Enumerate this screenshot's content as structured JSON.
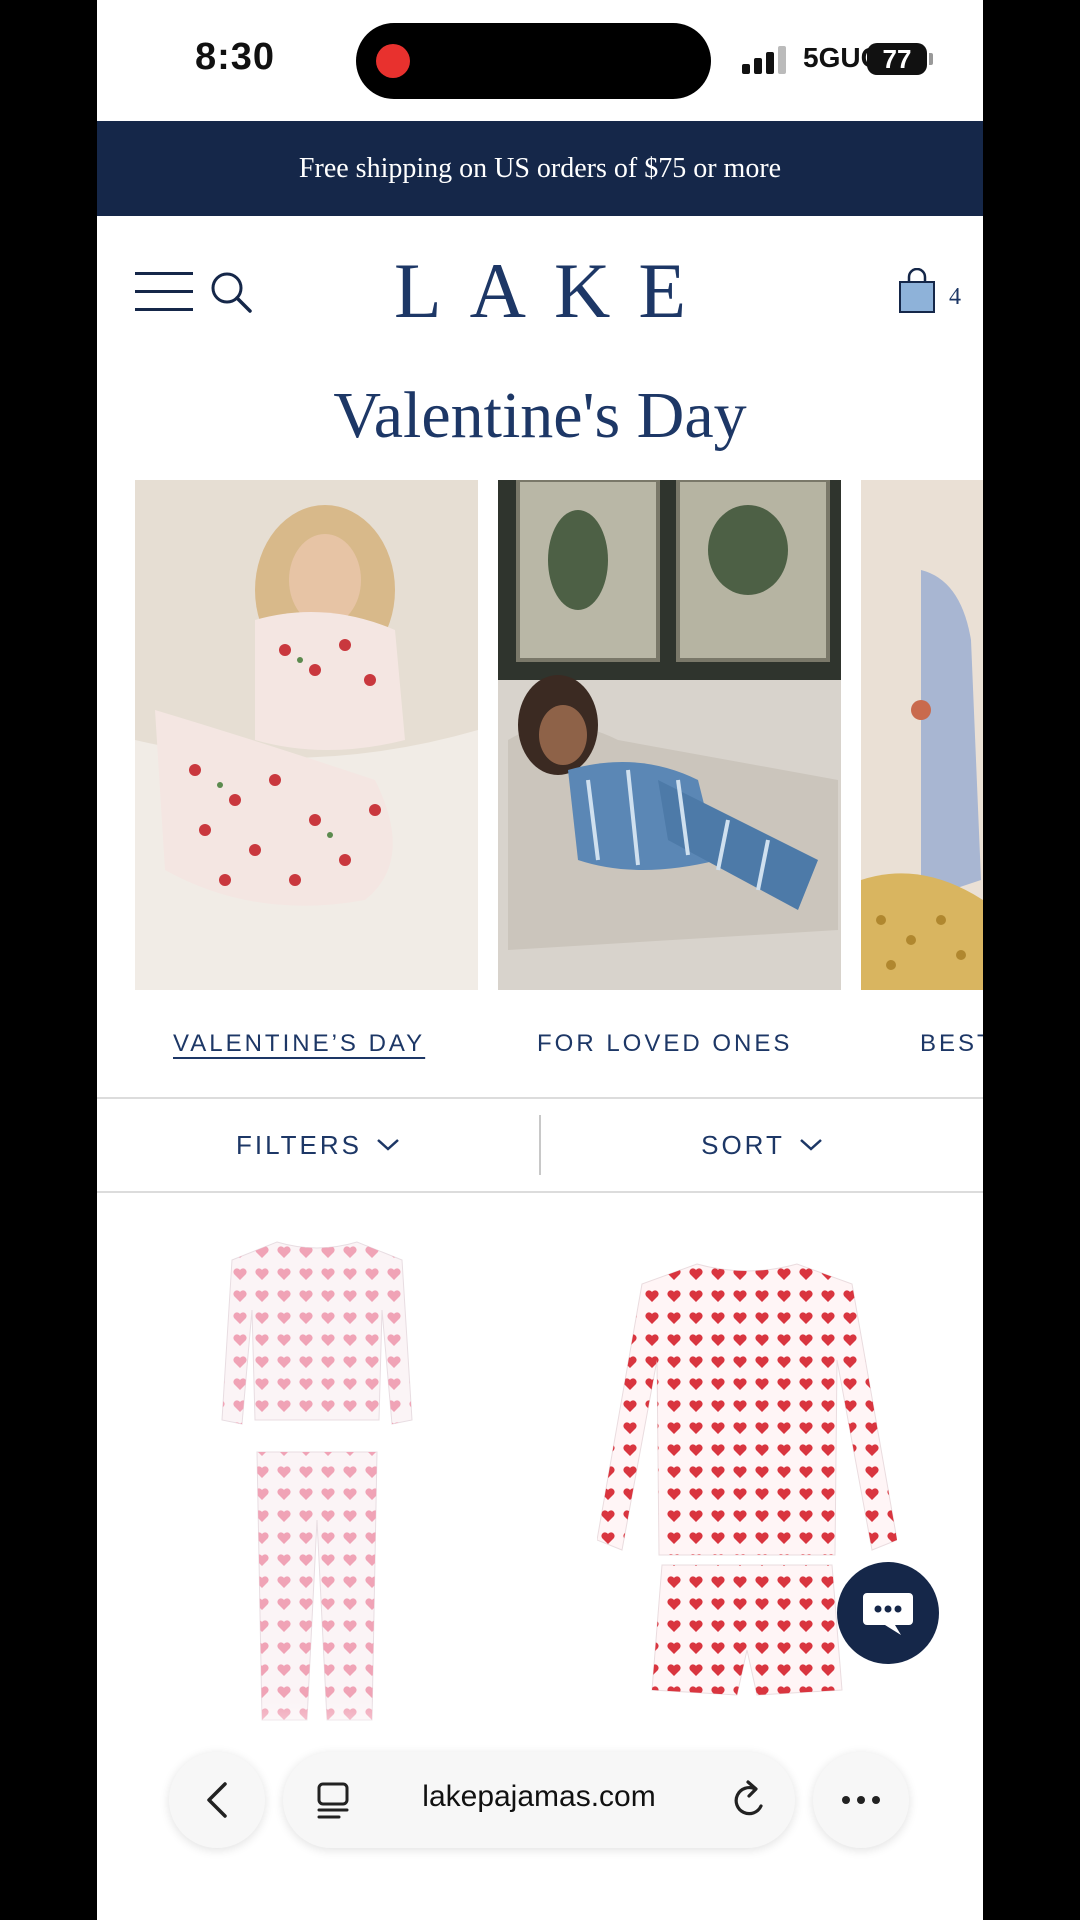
{
  "status_bar": {
    "time": "8:30",
    "network": "5GUC",
    "battery": "77"
  },
  "promo": {
    "text": "Free shipping on US orders of $75 or more"
  },
  "header": {
    "logo": "LAKE",
    "bag_count": "4"
  },
  "page": {
    "title": "Valentine's Day"
  },
  "categories": [
    {
      "label": "VALENTINE’S DAY"
    },
    {
      "label": "FOR LOVED ONES"
    },
    {
      "label": "BEST"
    }
  ],
  "toolbar": {
    "filters_label": "FILTERS",
    "sort_label": "SORT"
  },
  "browser": {
    "url": "lakepajamas.com"
  },
  "colors": {
    "navy": "#152749",
    "brand_text": "#1d3766",
    "heart_red": "#d9353f",
    "heart_pink": "#f0a3b6"
  }
}
